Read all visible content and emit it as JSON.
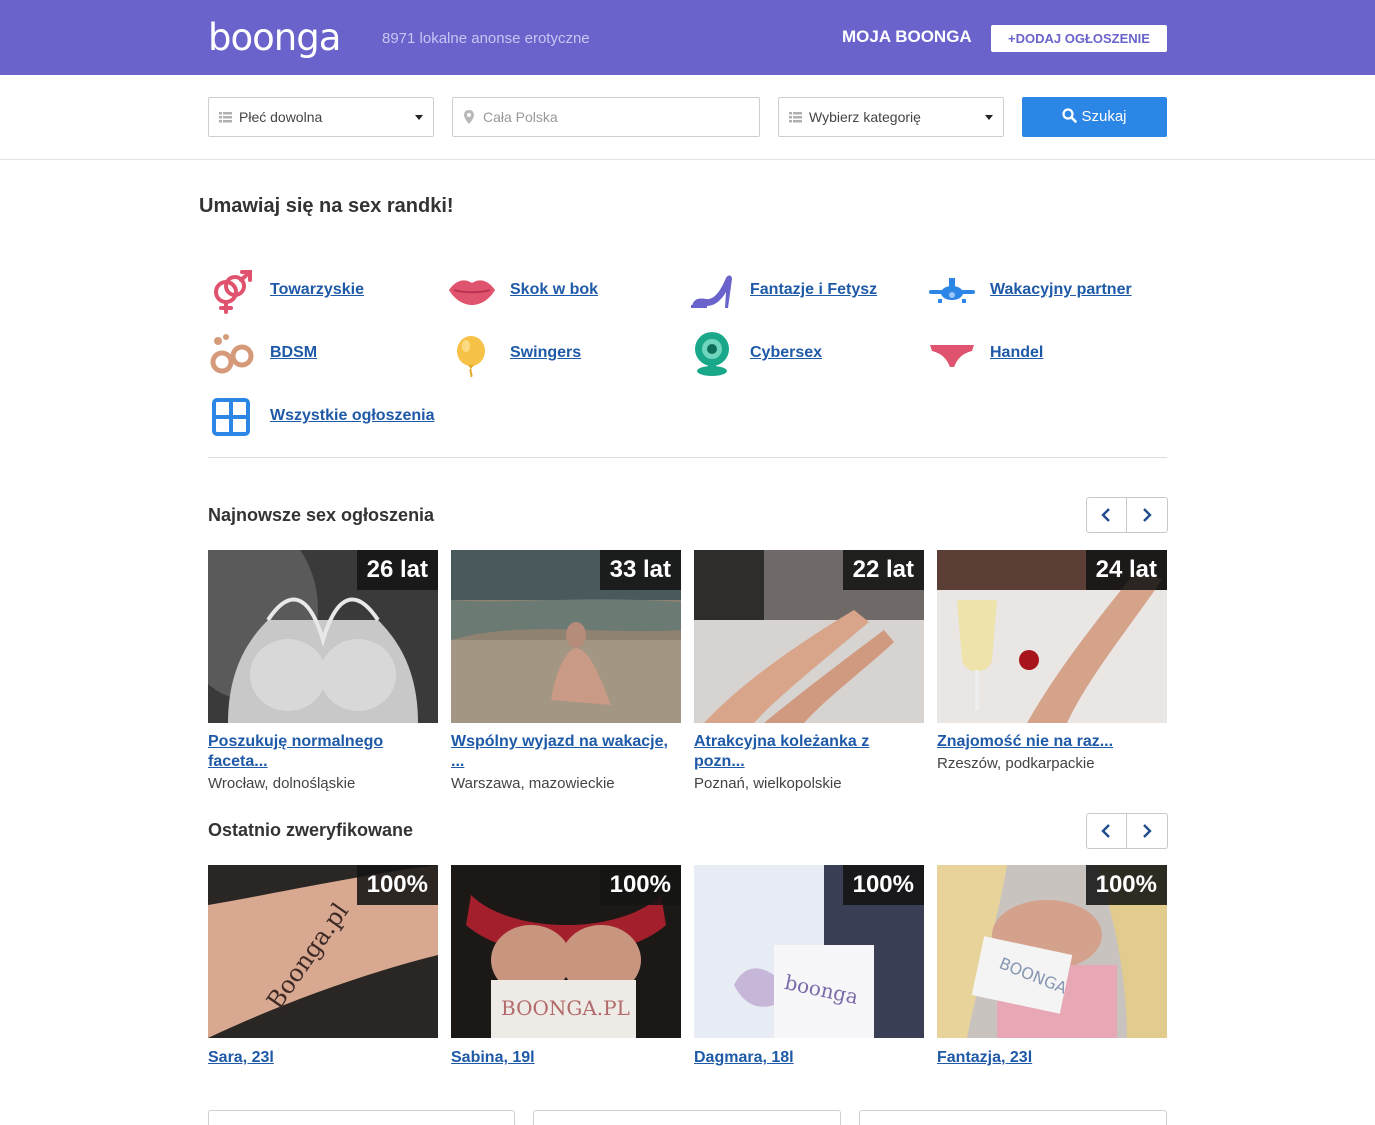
{
  "header": {
    "logo": "boonga",
    "tagline": "8971 lokalne anonse erotyczne",
    "my_account": "MOJA BOONGA",
    "add_ad": "+DODAJ OGŁOSZENIE",
    "bg_color": "#6a63cc"
  },
  "search": {
    "sex_select": "Płeć dowolna",
    "location_placeholder": "Cała Polska",
    "category_select": "Wybierz kategorię",
    "button": "Szukaj"
  },
  "headline": "Umawiaj się na sex randki!",
  "categories": [
    {
      "label": "Towarzyskie",
      "icon": "gender-symbols-icon"
    },
    {
      "label": "Skok w bok",
      "icon": "lips-icon"
    },
    {
      "label": "Fantazje i Fetysz",
      "icon": "high-heel-icon"
    },
    {
      "label": "Wakacyjny partner",
      "icon": "airplane-icon"
    },
    {
      "label": "BDSM",
      "icon": "handcuffs-icon"
    },
    {
      "label": "Swingers",
      "icon": "balloon-icon"
    },
    {
      "label": "Cybersex",
      "icon": "webcam-icon"
    },
    {
      "label": "Handel",
      "icon": "underwear-icon"
    },
    {
      "label": "Wszystkie ogłoszenia",
      "icon": "grid-icon"
    }
  ],
  "newest": {
    "title": "Najnowsze sex ogłoszenia",
    "cards": [
      {
        "badge": "26 lat",
        "title": "Poszukuję normalnego faceta...",
        "location": "Wrocław, dolnośląskie"
      },
      {
        "badge": "33 lat",
        "title": "Wspólny wyjazd na wakacje, ...",
        "location": "Warszawa, mazowieckie"
      },
      {
        "badge": "22 lat",
        "title": "Atrakcyjna koleżanka z pozn...",
        "location": "Poznań, wielkopolskie"
      },
      {
        "badge": "24 lat",
        "title": "Znajomość nie na raz...",
        "location": "Rzeszów, podkarpackie"
      }
    ]
  },
  "verified": {
    "title": "Ostatnio zweryfikowane",
    "cards": [
      {
        "badge": "100%",
        "title": "Sara, 23l",
        "sign": "Boonga.pl"
      },
      {
        "badge": "100%",
        "title": "Sabina, 19l",
        "sign": "BOONGA.PL"
      },
      {
        "badge": "100%",
        "title": "Dagmara, 18l",
        "sign": "boonga"
      },
      {
        "badge": "100%",
        "title": "Fantazja, 23l",
        "sign": "BOONGA"
      }
    ]
  }
}
